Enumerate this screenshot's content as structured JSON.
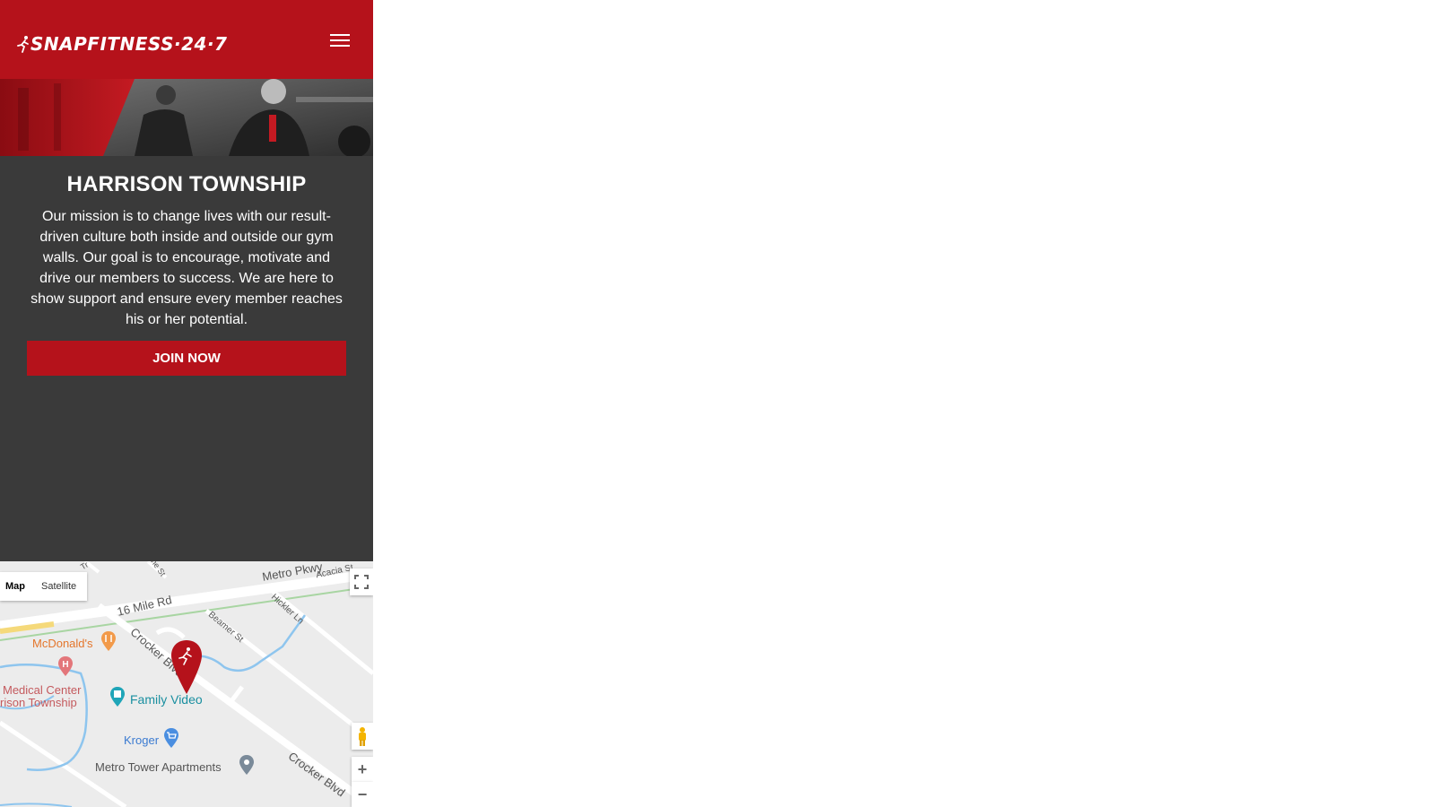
{
  "brand": {
    "logo_text": "SNAPFITNESS·24·7",
    "color": "#b5121b"
  },
  "header": {
    "menu_icon": "hamburger-menu-icon"
  },
  "location": {
    "title": "HARRISON TOWNSHIP",
    "mission": "Our mission is to change lives with our result-driven culture both inside and outside our gym walls. Our goal is to encourage, motivate and drive our members to success. We are here to show support and ensure every member reaches his or her potential.",
    "join_label": "JOIN NOW"
  },
  "map": {
    "type_options": [
      "Map",
      "Satellite"
    ],
    "selected_type": "Map",
    "roads": {
      "metro_pkwy": "Metro Pkwy",
      "acacia": "Acacia St",
      "mile16": "16 Mile Rd",
      "hickler": "Hickler Ln",
      "beamer": "Beamer St",
      "crocker": "Crocker Blvd",
      "crocker2": "Crocker Blvd",
      "tr": "Tr",
      "ne": "ne St"
    },
    "places": {
      "mcdonalds": "McDonald's",
      "medical1": "Medical Center",
      "medical2": "rison Township",
      "family_video": "Family Video",
      "kroger": "Kroger",
      "metro_tower": "Metro Tower Apartments"
    },
    "zoom_in": "+",
    "zoom_out": "−"
  }
}
